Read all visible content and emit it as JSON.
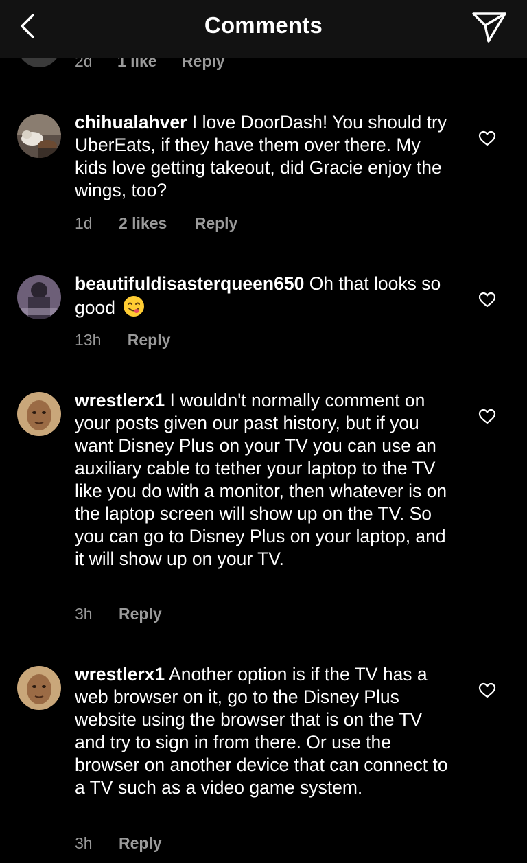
{
  "header": {
    "title": "Comments",
    "back_icon": "chevron-left-icon",
    "send_icon": "paper-plane-icon"
  },
  "cut_comment": {
    "time": "2d",
    "likes": "1 like",
    "reply": "Reply"
  },
  "comments": [
    {
      "username": "chihualahver",
      "text": "I love DoorDash! You should try UberEats, if they have them over there. My kids love getting takeout, did Gracie enjoy the wings, too?",
      "time": "1d",
      "likes": "2 likes",
      "reply": "Reply"
    },
    {
      "username": "beautifuldisasterqueen650",
      "text": "Oh that looks so good",
      "emoji": "face-savoring-food-emoji",
      "time": "13h",
      "reply": "Reply"
    },
    {
      "username": "wrestlerx1",
      "text": "I wouldn't normally comment on your posts given our past history, but if you want Disney Plus on your TV you can use an auxiliary cable to tether your laptop to the TV like you do with a monitor, then whatever is on the laptop screen will show up on the TV. So you can go to Disney Plus on your laptop, and it will show up on your TV.",
      "time": "3h",
      "reply": "Reply"
    },
    {
      "username": "wrestlerx1",
      "text": "Another option is if the TV has a web browser on it, go to the Disney Plus website using the browser that is on the TV and try to sign in from there. Or use the browser on another device that can connect to a TV such as a video game system.",
      "time": "3h",
      "reply": "Reply"
    }
  ],
  "colors": {
    "background": "#000000",
    "header": "#121212",
    "text": "#ffffff",
    "meta": "#9a9a9a"
  }
}
